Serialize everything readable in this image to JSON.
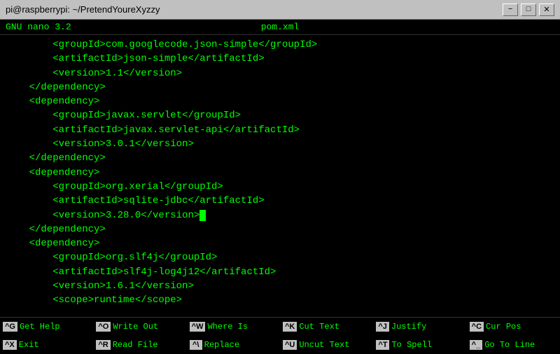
{
  "titlebar": {
    "title": "pi@raspberrypi: ~/PretendYoureXyzzy",
    "minimize": "−",
    "maximize": "□",
    "close": "✕"
  },
  "nano_header": {
    "left": "GNU nano  3.2",
    "center": "pom.xml"
  },
  "editor": {
    "lines": [
      "        <groupId>com.googlecode.json-simple</groupId>",
      "        <artifactId>json-simple</artifactId>",
      "        <version>1.1</version>",
      "    </dependency>",
      "    <dependency>",
      "        <groupId>javax.servlet</groupId>",
      "        <artifactId>javax.servlet-api</artifactId>",
      "        <version>3.0.1</version>",
      "    </dependency>",
      "    <dependency>",
      "        <groupId>org.xerial</groupId>",
      "        <artifactId>sqlite-jdbc</artifactId>",
      "        <version>3.28.0</version>",
      "    </dependency>",
      "    <dependency>",
      "        <groupId>org.slf4j</groupId>",
      "        <artifactId>slf4j-log4j12</artifactId>",
      "        <version>1.6.1</version>",
      "        <scope>runtime</scope>"
    ],
    "cursor_line": 12,
    "cursor_after": "        <version>3.28.0</version>"
  },
  "bottom_bar": {
    "items": [
      {
        "key": "^G",
        "label": "Get Help"
      },
      {
        "key": "^O",
        "label": "Write Out"
      },
      {
        "key": "^W",
        "label": "Where Is"
      },
      {
        "key": "^K",
        "label": "Cut Text"
      },
      {
        "key": "^J",
        "label": "Justify"
      },
      {
        "key": "^C",
        "label": "Cur Pos"
      },
      {
        "key": "^X",
        "label": "Exit"
      },
      {
        "key": "^R",
        "label": "Read File"
      },
      {
        "key": "^\\",
        "label": "Replace"
      },
      {
        "key": "^U",
        "label": "Uncut Text"
      },
      {
        "key": "^T",
        "label": "To Spell"
      },
      {
        "key": "^_",
        "label": "Go To Line"
      }
    ]
  }
}
